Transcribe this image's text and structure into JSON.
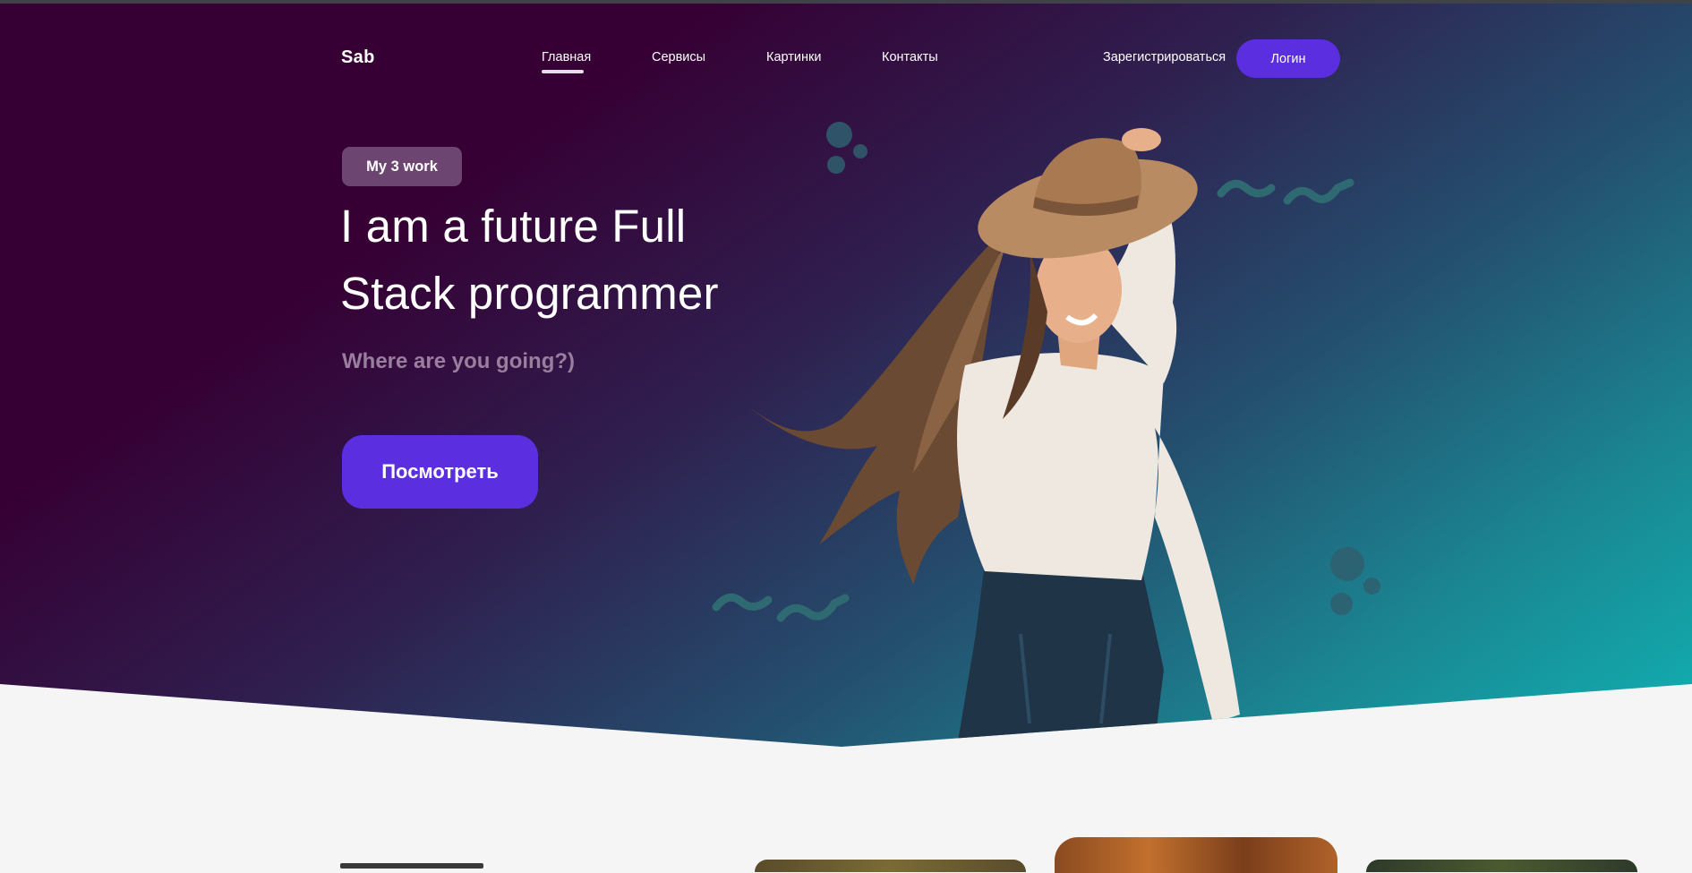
{
  "nav": {
    "logo": "Sab",
    "links": [
      {
        "label": "Главная",
        "active": true
      },
      {
        "label": "Сервисы",
        "active": false
      },
      {
        "label": "Картинки",
        "active": false
      },
      {
        "label": "Контакты",
        "active": false
      }
    ],
    "register_label": "Зарегистрироваться",
    "login_label": "Логин"
  },
  "hero": {
    "badge": "My 3 work",
    "headline_line1": "I am a future Full",
    "headline_line2": "Stack programmer",
    "subtitle": "Where are you going?)",
    "cta_label": "Посмотреть",
    "image": "woman-in-hat-photo"
  },
  "colors": {
    "accent": "#5b2ee0",
    "gradient_start": "#360034",
    "gradient_end": "#10b1b3",
    "badge_bg": "#6c4570",
    "subtitle": "#9a7e9e",
    "decor": "#2f5f6f",
    "page_bg": "#f5f5f6"
  }
}
